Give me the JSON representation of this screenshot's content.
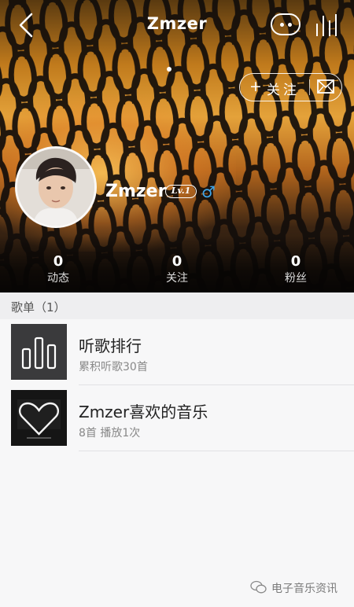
{
  "header": {
    "title": "Zmzer",
    "follow_plus": "+",
    "follow_label": "关注"
  },
  "profile": {
    "username": "Zmzer",
    "level": "Lv.1",
    "gender_symbol": "♂"
  },
  "stats": [
    {
      "value": "0",
      "label": "动态"
    },
    {
      "value": "0",
      "label": "关注"
    },
    {
      "value": "0",
      "label": "粉丝"
    }
  ],
  "playlists": {
    "section_title": "歌单（1）",
    "items": [
      {
        "name": "听歌排行",
        "meta": "累积听歌30首"
      },
      {
        "name": "Zmzer喜欢的音乐",
        "meta": "8首  播放1次"
      }
    ]
  },
  "watermark": {
    "text": "电子音乐资讯"
  },
  "colors": {
    "accent_gender": "#3ea6ea",
    "page_bg": "#f7f7f8",
    "section_bg": "#eeeef0"
  },
  "icons": [
    "back-arrow-icon",
    "more-dots-icon",
    "now-playing-icon",
    "mail-icon",
    "male-icon",
    "bar-chart-icon",
    "heart-icon",
    "wechat-icon"
  ]
}
